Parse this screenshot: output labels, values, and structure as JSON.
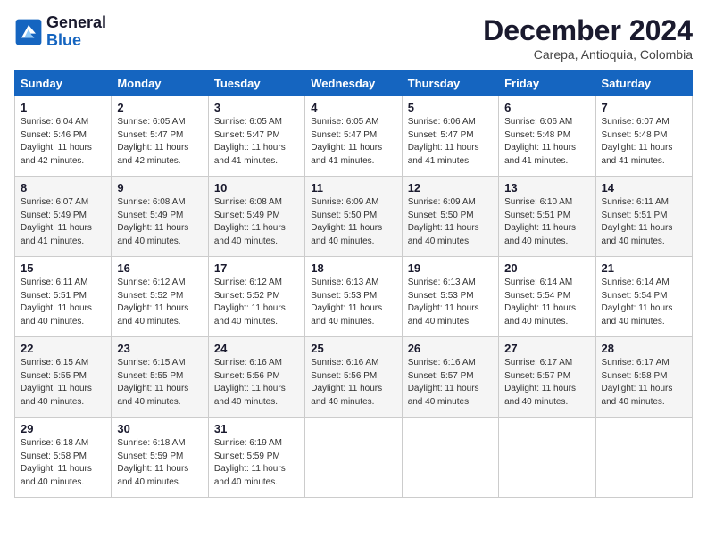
{
  "header": {
    "logo_line1": "General",
    "logo_line2": "Blue",
    "month": "December 2024",
    "location": "Carepa, Antioquia, Colombia"
  },
  "weekdays": [
    "Sunday",
    "Monday",
    "Tuesday",
    "Wednesday",
    "Thursday",
    "Friday",
    "Saturday"
  ],
  "weeks": [
    [
      {
        "day": "1",
        "sunrise": "6:04 AM",
        "sunset": "5:46 PM",
        "daylight": "11 hours and 42 minutes."
      },
      {
        "day": "2",
        "sunrise": "6:05 AM",
        "sunset": "5:47 PM",
        "daylight": "11 hours and 42 minutes."
      },
      {
        "day": "3",
        "sunrise": "6:05 AM",
        "sunset": "5:47 PM",
        "daylight": "11 hours and 41 minutes."
      },
      {
        "day": "4",
        "sunrise": "6:05 AM",
        "sunset": "5:47 PM",
        "daylight": "11 hours and 41 minutes."
      },
      {
        "day": "5",
        "sunrise": "6:06 AM",
        "sunset": "5:47 PM",
        "daylight": "11 hours and 41 minutes."
      },
      {
        "day": "6",
        "sunrise": "6:06 AM",
        "sunset": "5:48 PM",
        "daylight": "11 hours and 41 minutes."
      },
      {
        "day": "7",
        "sunrise": "6:07 AM",
        "sunset": "5:48 PM",
        "daylight": "11 hours and 41 minutes."
      }
    ],
    [
      {
        "day": "8",
        "sunrise": "6:07 AM",
        "sunset": "5:49 PM",
        "daylight": "11 hours and 41 minutes."
      },
      {
        "day": "9",
        "sunrise": "6:08 AM",
        "sunset": "5:49 PM",
        "daylight": "11 hours and 40 minutes."
      },
      {
        "day": "10",
        "sunrise": "6:08 AM",
        "sunset": "5:49 PM",
        "daylight": "11 hours and 40 minutes."
      },
      {
        "day": "11",
        "sunrise": "6:09 AM",
        "sunset": "5:50 PM",
        "daylight": "11 hours and 40 minutes."
      },
      {
        "day": "12",
        "sunrise": "6:09 AM",
        "sunset": "5:50 PM",
        "daylight": "11 hours and 40 minutes."
      },
      {
        "day": "13",
        "sunrise": "6:10 AM",
        "sunset": "5:51 PM",
        "daylight": "11 hours and 40 minutes."
      },
      {
        "day": "14",
        "sunrise": "6:11 AM",
        "sunset": "5:51 PM",
        "daylight": "11 hours and 40 minutes."
      }
    ],
    [
      {
        "day": "15",
        "sunrise": "6:11 AM",
        "sunset": "5:51 PM",
        "daylight": "11 hours and 40 minutes."
      },
      {
        "day": "16",
        "sunrise": "6:12 AM",
        "sunset": "5:52 PM",
        "daylight": "11 hours and 40 minutes."
      },
      {
        "day": "17",
        "sunrise": "6:12 AM",
        "sunset": "5:52 PM",
        "daylight": "11 hours and 40 minutes."
      },
      {
        "day": "18",
        "sunrise": "6:13 AM",
        "sunset": "5:53 PM",
        "daylight": "11 hours and 40 minutes."
      },
      {
        "day": "19",
        "sunrise": "6:13 AM",
        "sunset": "5:53 PM",
        "daylight": "11 hours and 40 minutes."
      },
      {
        "day": "20",
        "sunrise": "6:14 AM",
        "sunset": "5:54 PM",
        "daylight": "11 hours and 40 minutes."
      },
      {
        "day": "21",
        "sunrise": "6:14 AM",
        "sunset": "5:54 PM",
        "daylight": "11 hours and 40 minutes."
      }
    ],
    [
      {
        "day": "22",
        "sunrise": "6:15 AM",
        "sunset": "5:55 PM",
        "daylight": "11 hours and 40 minutes."
      },
      {
        "day": "23",
        "sunrise": "6:15 AM",
        "sunset": "5:55 PM",
        "daylight": "11 hours and 40 minutes."
      },
      {
        "day": "24",
        "sunrise": "6:16 AM",
        "sunset": "5:56 PM",
        "daylight": "11 hours and 40 minutes."
      },
      {
        "day": "25",
        "sunrise": "6:16 AM",
        "sunset": "5:56 PM",
        "daylight": "11 hours and 40 minutes."
      },
      {
        "day": "26",
        "sunrise": "6:16 AM",
        "sunset": "5:57 PM",
        "daylight": "11 hours and 40 minutes."
      },
      {
        "day": "27",
        "sunrise": "6:17 AM",
        "sunset": "5:57 PM",
        "daylight": "11 hours and 40 minutes."
      },
      {
        "day": "28",
        "sunrise": "6:17 AM",
        "sunset": "5:58 PM",
        "daylight": "11 hours and 40 minutes."
      }
    ],
    [
      {
        "day": "29",
        "sunrise": "6:18 AM",
        "sunset": "5:58 PM",
        "daylight": "11 hours and 40 minutes."
      },
      {
        "day": "30",
        "sunrise": "6:18 AM",
        "sunset": "5:59 PM",
        "daylight": "11 hours and 40 minutes."
      },
      {
        "day": "31",
        "sunrise": "6:19 AM",
        "sunset": "5:59 PM",
        "daylight": "11 hours and 40 minutes."
      },
      null,
      null,
      null,
      null
    ]
  ]
}
